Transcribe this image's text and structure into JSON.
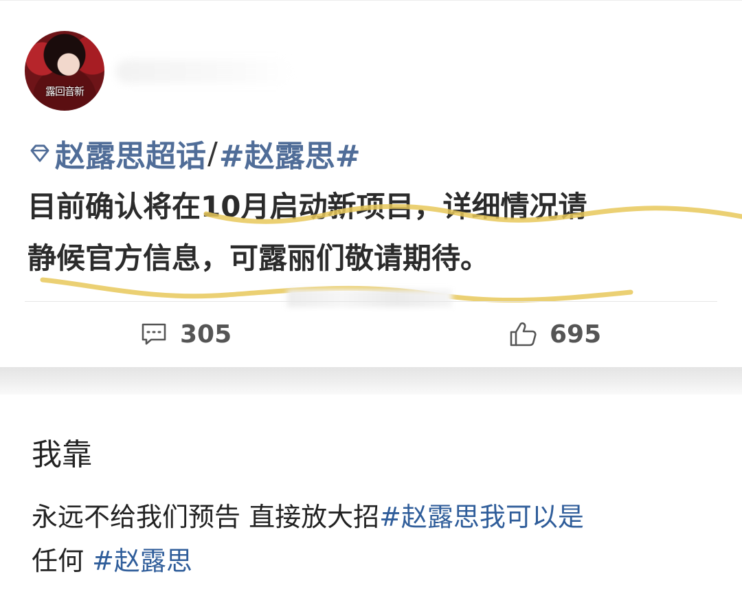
{
  "post_card": {
    "topic": "赵露思超话",
    "separator": "/",
    "hashtag": "#赵露思#",
    "avatar_caption": "露回音新",
    "body_lines": [
      "目前确认将在10月启动新项目，详细情况请",
      "静候官方信息，可露丽们敬请期待。"
    ],
    "comment_count": "305",
    "like_count": "695",
    "icons": {
      "topic": "diamond-icon",
      "comment": "comment-icon",
      "like": "thumbs-up-icon"
    },
    "colors": {
      "topic_link": "#506d98",
      "highlight_stroke": "#e8c85a"
    }
  },
  "reply_post": {
    "title": "我靠",
    "line1_text": "永远不给我们预告 直接放大招",
    "line1_tag": "#赵露思我可以是",
    "line2_text": "任何 ",
    "line2_tag": "#赵露思",
    "colors": {
      "tag": "#2f5d9a"
    }
  }
}
